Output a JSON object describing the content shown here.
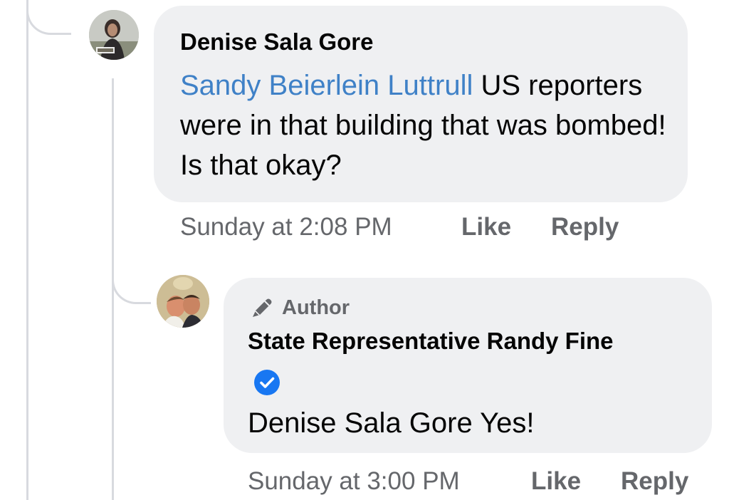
{
  "comment": {
    "author": "Denise Sala Gore",
    "mention": "Sandy Beierlein Luttrull",
    "text": " US reporters were in that building that was bombed! Is that okay?",
    "timestamp": "Sunday at 2:08 PM",
    "like_label": "Like",
    "reply_label": "Reply",
    "avatar_icon": "profile-photo-icon"
  },
  "reply": {
    "badge_label": "Author",
    "badge_icon": "pencil-icon",
    "author": "State Representative Randy Fine",
    "verified_icon": "verified-check-icon",
    "verified_color": "#1877f2",
    "text": "Denise Sala Gore Yes!",
    "timestamp": "Sunday at 3:00 PM",
    "like_label": "Like",
    "reply_label": "Reply",
    "avatar_icon": "profile-photo-icon"
  },
  "colors": {
    "bubble": "#eff0f2",
    "mention": "#3f81c7",
    "meta": "#65676b",
    "thread_line": "#d8dadf"
  }
}
